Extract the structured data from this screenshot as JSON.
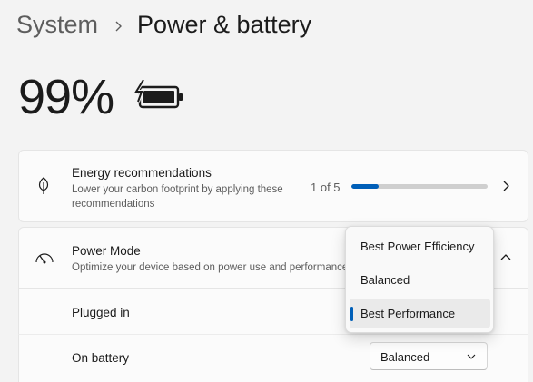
{
  "breadcrumb": {
    "parent": "System",
    "current": "Power & battery"
  },
  "battery": {
    "percent_label": "99%",
    "charging_icon": "battery-charging-icon"
  },
  "energy": {
    "icon": "leaf-icon",
    "title": "Energy recommendations",
    "description": "Lower your carbon footprint by applying these recommendations",
    "pager": "1 of 5",
    "progress_fraction": 0.2
  },
  "power_mode": {
    "icon": "gauge-icon",
    "title": "Power Mode",
    "description": "Optimize your device based on power use and performance",
    "plugged_in_label": "Plugged in",
    "on_battery_label": "On battery",
    "on_battery_value": "Balanced",
    "options": [
      "Best Power Efficiency",
      "Balanced",
      "Best Performance"
    ],
    "selected_option": "Best Performance"
  },
  "colors": {
    "accent": "#005fb8",
    "page_bg": "#f3f3f3",
    "card_bg": "#fbfbfb"
  }
}
